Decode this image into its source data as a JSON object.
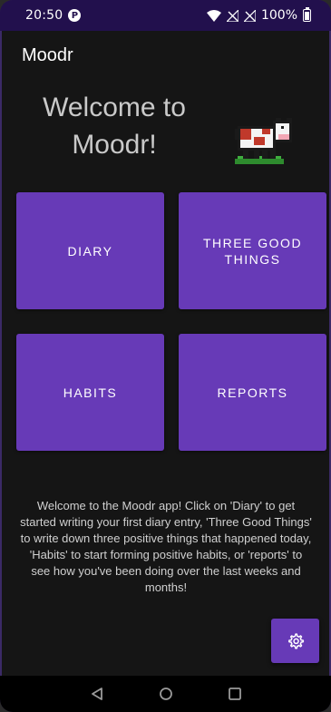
{
  "status_bar": {
    "time": "20:50",
    "notification_badge": "P",
    "battery_percent": "100%",
    "icons": [
      "wifi-icon",
      "signal-off-icon",
      "signal-off-icon",
      "battery-icon"
    ]
  },
  "app_bar": {
    "title": "Moodr"
  },
  "welcome": {
    "title": "Welcome to Moodr!"
  },
  "tiles": {
    "diary": "DIARY",
    "three_good_things": "THREE GOOD THINGS",
    "habits": "HABITS",
    "reports": "REPORTS"
  },
  "description": "Welcome to the Moodr app! Click on 'Diary' to get started writing your first diary entry, 'Three Good Things' to write down three positive things that happened today, 'Habits' to start forming positive habits, or 'reports' to see how you've been doing over the last weeks and months!",
  "fab": {
    "icon": "settings-gear-icon"
  },
  "nav_bar": {
    "icons": [
      "back-icon",
      "home-icon",
      "recents-icon"
    ]
  },
  "colors": {
    "status_bar": "#22104d",
    "background": "#151515",
    "accent": "#673ab7"
  }
}
